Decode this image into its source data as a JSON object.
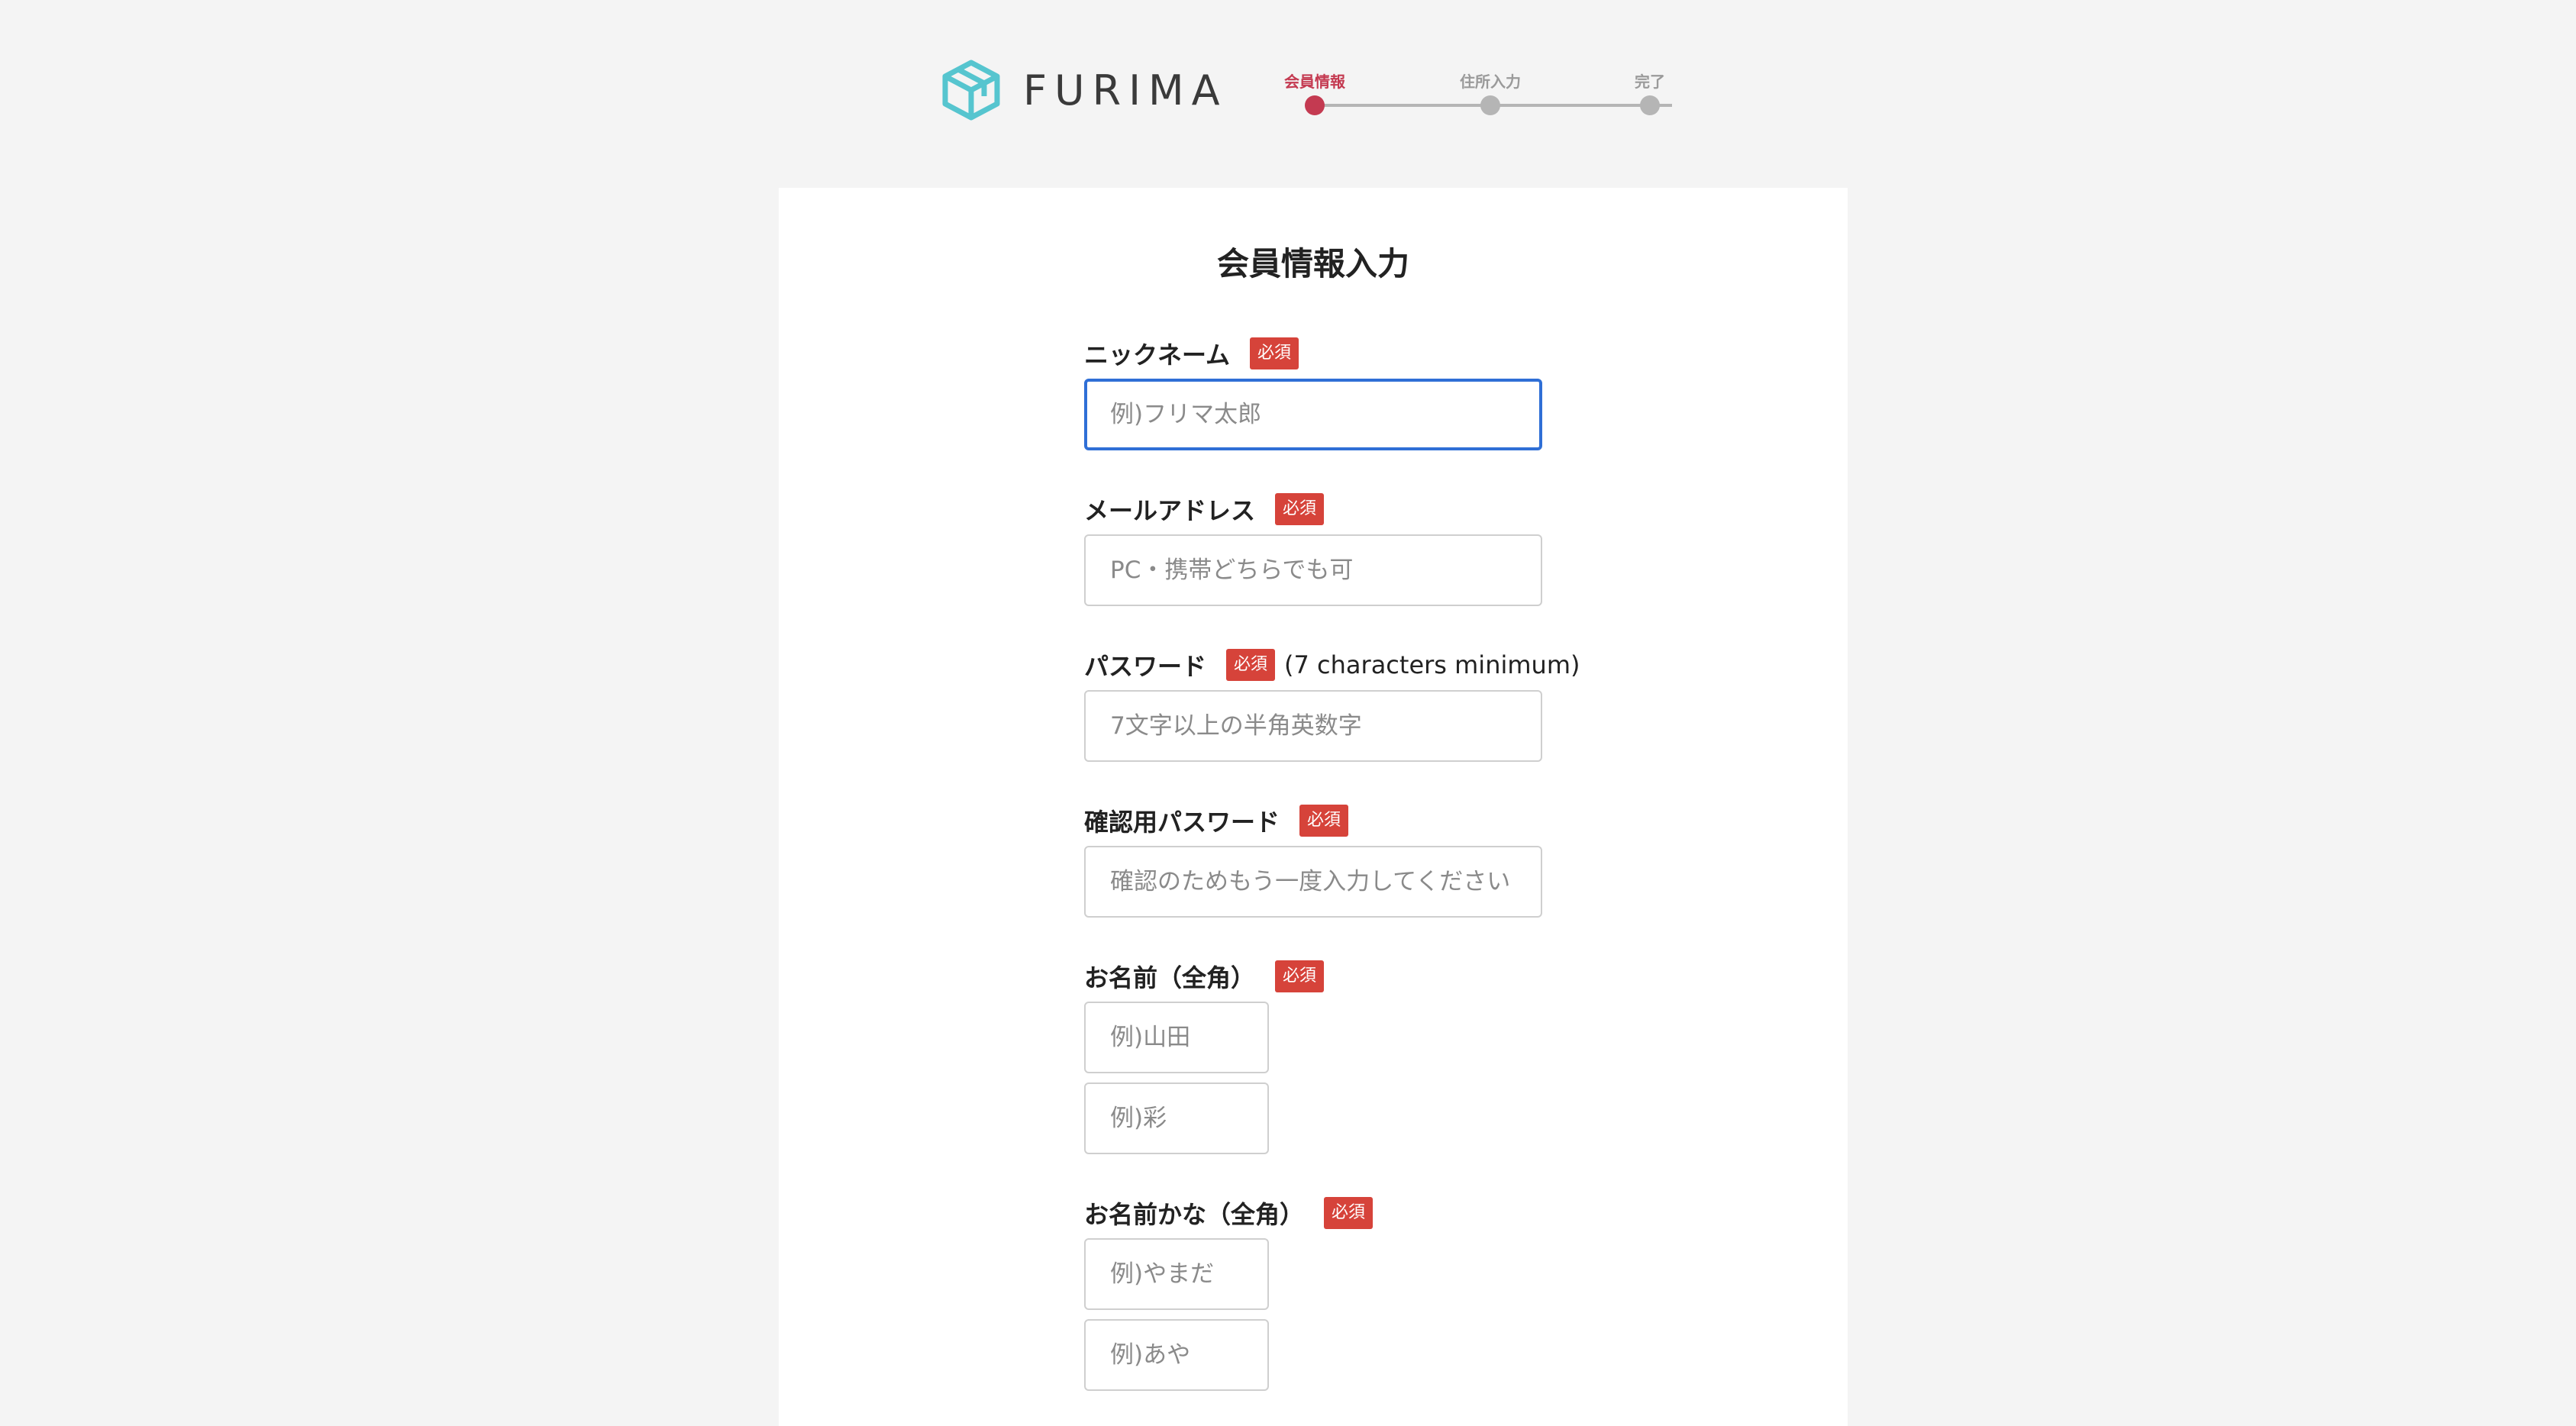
{
  "brand": {
    "name": "FURIMA",
    "logo_icon": "cube-icon",
    "accent": "#56c5cf"
  },
  "progress": {
    "steps": [
      {
        "label": "会員情報",
        "active": true
      },
      {
        "label": "住所入力",
        "active": false
      },
      {
        "label": "完了",
        "active": false
      }
    ],
    "active_color": "#c43a51",
    "inactive_color": "#b5b5b5"
  },
  "form": {
    "title": "会員情報入力",
    "required_label": "必須",
    "required_color": "#d6433a",
    "focus_color": "#2f6fd6",
    "fields": {
      "nickname": {
        "label": "ニックネーム",
        "placeholder": "例)フリマ太郎",
        "value": ""
      },
      "email": {
        "label": "メールアドレス",
        "placeholder": "PC・携帯どちらでも可",
        "value": ""
      },
      "password": {
        "label": "パスワード",
        "hint": "(7 characters minimum)",
        "placeholder": "7文字以上の半角英数字",
        "value": ""
      },
      "password_confirm": {
        "label": "確認用パスワード",
        "placeholder": "確認のためもう一度入力してください",
        "value": ""
      },
      "name": {
        "label": "お名前（全角）",
        "last_placeholder": "例)山田",
        "first_placeholder": "例)彩"
      },
      "name_kana": {
        "label": "お名前かな（全角）",
        "last_placeholder": "例)やまだ",
        "first_placeholder": "例)あや"
      }
    }
  }
}
